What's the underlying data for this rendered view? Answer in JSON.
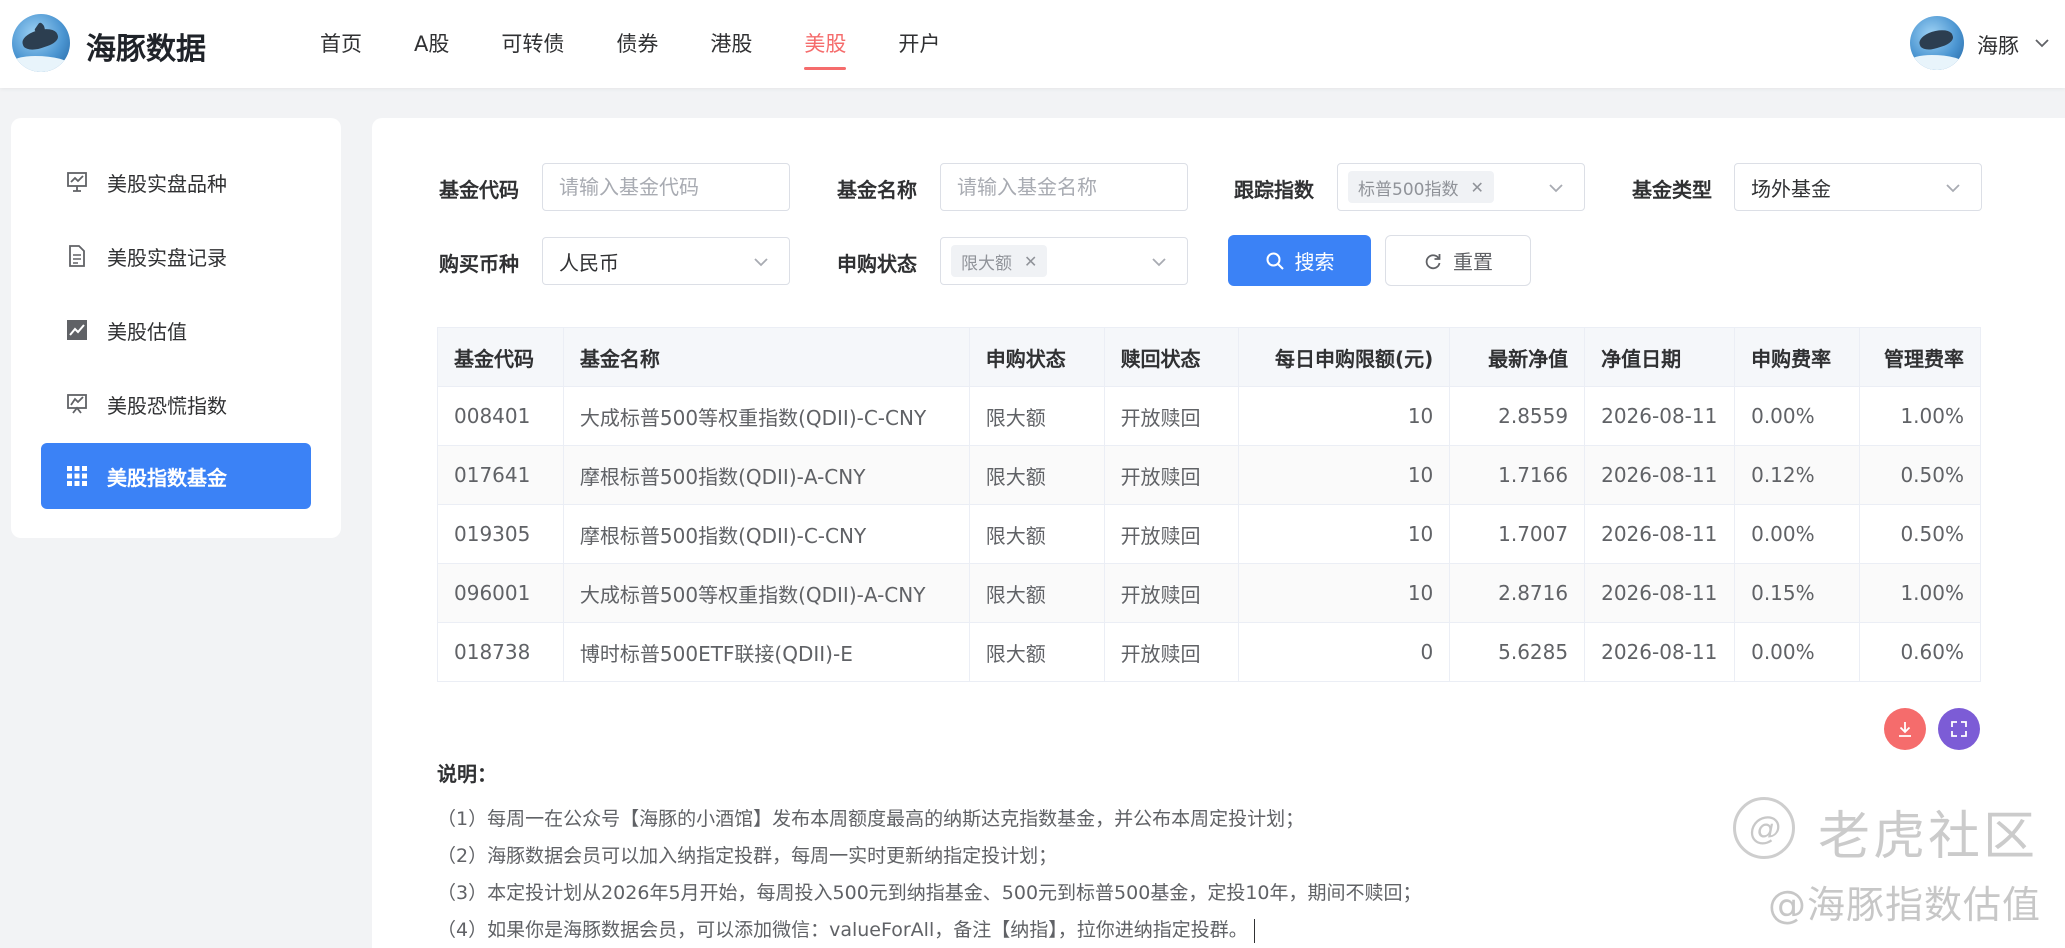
{
  "header": {
    "brand": "海豚数据",
    "nav": [
      "首页",
      "A股",
      "可转债",
      "债券",
      "港股",
      "美股",
      "开户"
    ],
    "active_nav": "美股",
    "user_name": "海豚"
  },
  "sidebar": {
    "items": [
      {
        "label": "美股实盘品种",
        "icon": "presentation-chart-icon"
      },
      {
        "label": "美股实盘记录",
        "icon": "document-icon"
      },
      {
        "label": "美股估值",
        "icon": "line-chart-icon"
      },
      {
        "label": "美股恐慌指数",
        "icon": "trend-board-icon"
      },
      {
        "label": "美股指数基金",
        "icon": "grid-icon",
        "active": true
      }
    ]
  },
  "filters": {
    "fund_code_label": "基金代码",
    "fund_code_placeholder": "请输入基金代码",
    "fund_name_label": "基金名称",
    "fund_name_placeholder": "请输入基金名称",
    "track_index_label": "跟踪指数",
    "track_index_tag": "标普500指数",
    "fund_type_label": "基金类型",
    "fund_type_value": "场外基金",
    "currency_label": "购买币种",
    "currency_value": "人民币",
    "subscribe_status_label": "申购状态",
    "subscribe_status_tag": "限大额",
    "search_label": "搜索",
    "reset_label": "重置"
  },
  "table": {
    "headers": [
      "基金代码",
      "基金名称",
      "申购状态",
      "赎回状态",
      "每日申购限额(元)",
      "最新净值",
      "净值日期",
      "申购费率",
      "管理费率"
    ],
    "rows": [
      [
        "008401",
        "大成标普500等权重指数(QDII)-C-CNY",
        "限大额",
        "开放赎回",
        "10",
        "2.8559",
        "2026-08-11",
        "0.00%",
        "1.00%"
      ],
      [
        "017641",
        "摩根标普500指数(QDII)-A-CNY",
        "限大额",
        "开放赎回",
        "10",
        "1.7166",
        "2026-08-11",
        "0.12%",
        "0.50%"
      ],
      [
        "019305",
        "摩根标普500指数(QDII)-C-CNY",
        "限大额",
        "开放赎回",
        "10",
        "1.7007",
        "2026-08-11",
        "0.00%",
        "0.50%"
      ],
      [
        "096001",
        "大成标普500等权重指数(QDII)-A-CNY",
        "限大额",
        "开放赎回",
        "10",
        "2.8716",
        "2026-08-11",
        "0.15%",
        "1.00%"
      ],
      [
        "018738",
        "博时标普500ETF联接(QDII)-E",
        "限大额",
        "开放赎回",
        "0",
        "5.6285",
        "2026-08-11",
        "0.00%",
        "0.60%"
      ]
    ]
  },
  "notes": {
    "title": "说明：",
    "lines": [
      "（1）每周一在公众号【海豚的小酒馆】发布本周额度最高的纳斯达克指数基金，并公布本周定投计划；",
      "（2）海豚数据会员可以加入纳指定投群，每周一实时更新纳指定投计划；",
      "（3）本定投计划从2026年5月开始，每周投入500元到纳指基金、500元到标普500基金，定投10年，期间不赎回；",
      "（4）如果你是海豚数据会员，可以添加微信：valueForAll，备注【纳指】，拉你进纳指定投群。"
    ]
  },
  "watermark": {
    "line1": "老虎社区",
    "line2": "@海豚指数估值"
  },
  "colors": {
    "primary": "#3b82f6",
    "nav_active": "#f56c6c",
    "fab_download": "#f56c6c",
    "fab_fullscreen": "#7c5cd6"
  }
}
